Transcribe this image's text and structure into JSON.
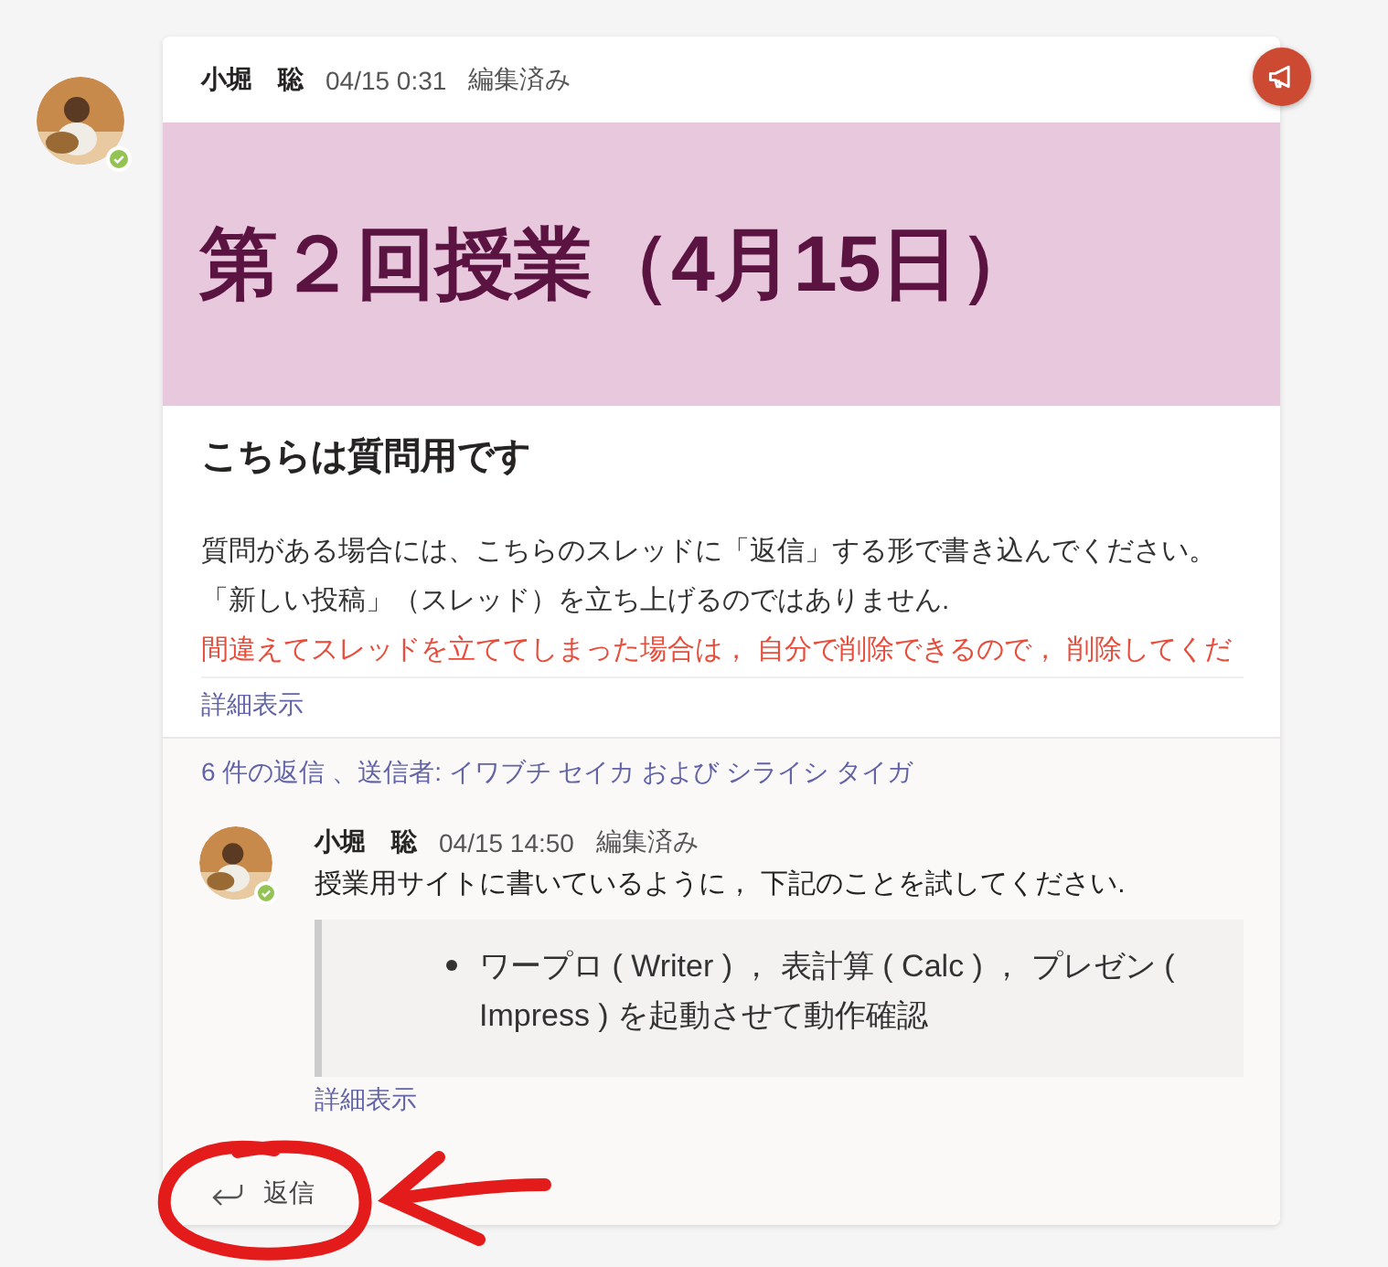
{
  "post": {
    "author": "小堀　聡",
    "time": "04/15 0:31",
    "edited": "編集済み",
    "online": true,
    "announcement": true,
    "banner": "第２回授業（4月15日）",
    "subject": "こちらは質問用です",
    "body": [
      {
        "kind": "normal",
        "text": "質問がある場合には、こちらのスレッドに「返信」する形で書き込んでください。"
      },
      {
        "kind": "normal",
        "text": "「新しい投稿」（スレッド）を立ち上げるのではありません."
      },
      {
        "kind": "warning",
        "text": "間違えてスレッドを立ててしまった場合は， 自分で削除できるので， 削除してくだ"
      }
    ],
    "see_more": "詳細表示"
  },
  "replies_summary": "6 件の返信 、送信者: イワブチ セイカ および シライシ タイガ",
  "reply": {
    "author": "小堀　聡",
    "time": "04/15 14:50",
    "edited": "編集済み",
    "online": true,
    "text": "授業用サイトに書いているように， 下記のことを試してください.",
    "quote_items": [
      "ワープロ ( Writer ) ， 表計算 ( Calc ) ， プレゼン ( Impress ) を起動させて動作確認"
    ],
    "see_more": "詳細表示"
  },
  "reply_button": "返信",
  "annotation": {
    "kind": "circle-and-arrow"
  }
}
